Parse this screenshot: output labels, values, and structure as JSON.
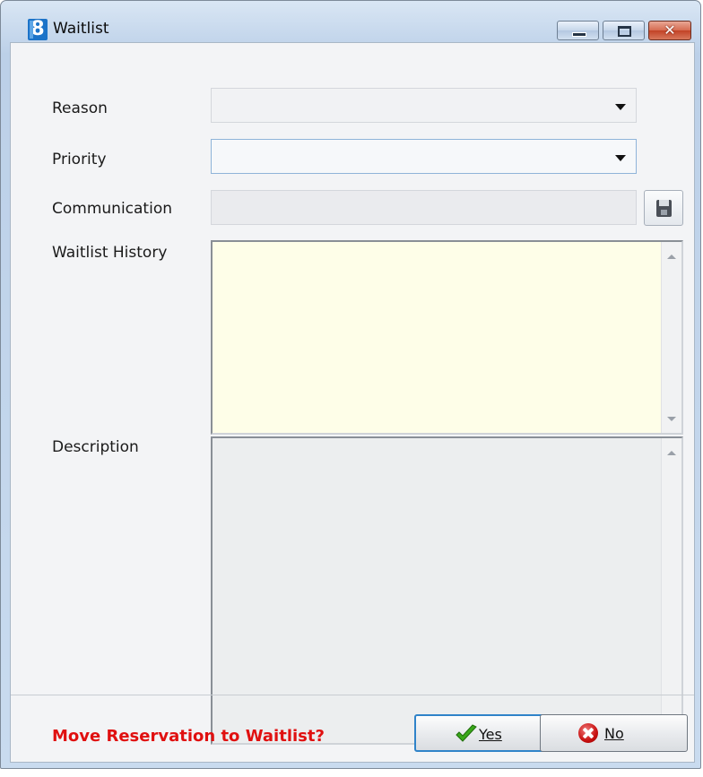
{
  "window": {
    "title": "Waitlist",
    "app_icon_glyph": "8",
    "caption": {
      "minimize_icon": "minimize-icon",
      "maximize_icon": "maximize-icon",
      "close_glyph": "✕"
    }
  },
  "form": {
    "reason": {
      "label": "Reason",
      "value": ""
    },
    "priority": {
      "label": "Priority",
      "value": ""
    },
    "communication": {
      "label": "Communication",
      "value": "",
      "button_icon": "save-icon"
    },
    "waitlist_history": {
      "label": "Waitlist History",
      "value": ""
    },
    "description": {
      "label": "Description",
      "value": ""
    }
  },
  "footer": {
    "prompt": "Move Reservation to Waitlist?",
    "yes_label": "Yes",
    "no_label": "No"
  },
  "colors": {
    "prompt": "#e01010",
    "history_background": "#fefee8",
    "title_bar": "#c5d7ec"
  }
}
